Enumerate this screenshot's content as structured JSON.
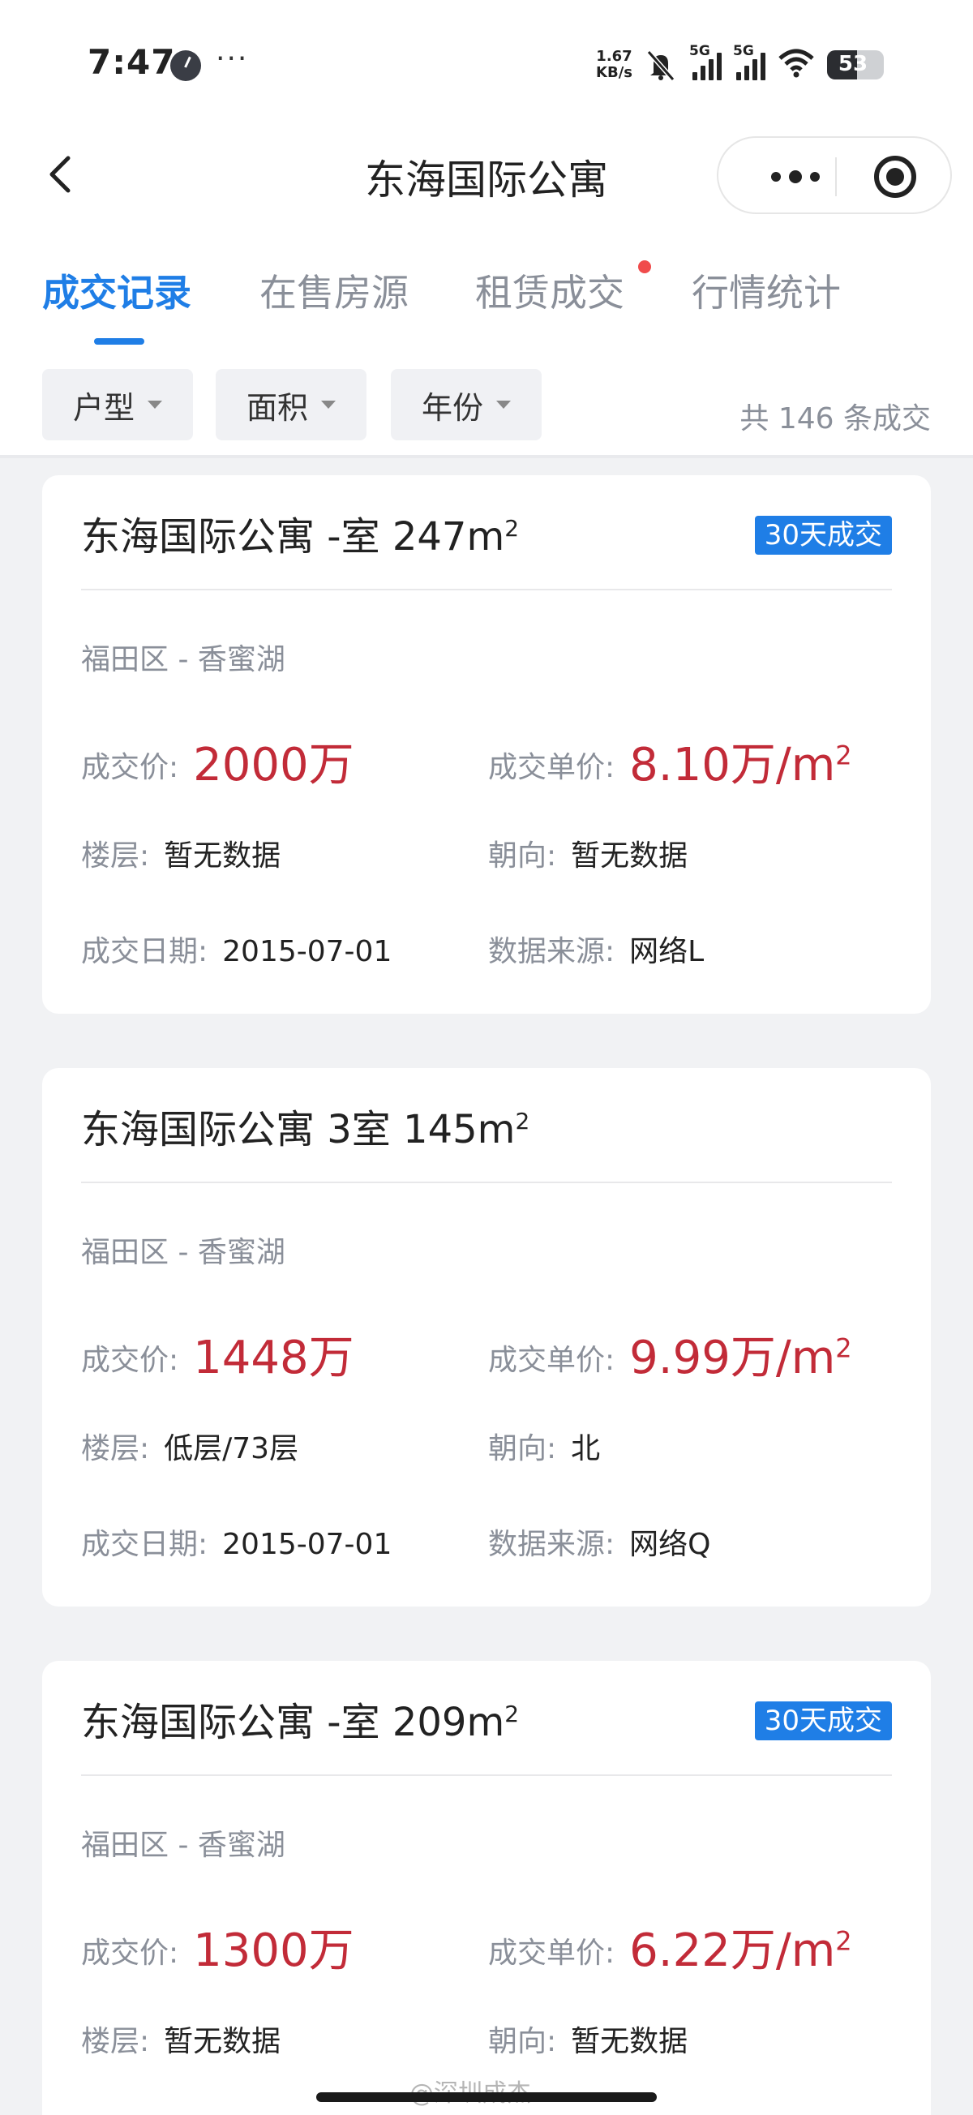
{
  "status_bar": {
    "time": "7:47",
    "dots": "···",
    "speed_value": "1.67",
    "speed_unit": "KB/s",
    "signal1_label": "5G",
    "signal2_label": "5G",
    "battery": "53"
  },
  "nav": {
    "title": "东海国际公寓"
  },
  "tabs": [
    {
      "label": "成交记录",
      "active": true
    },
    {
      "label": "在售房源",
      "active": false
    },
    {
      "label": "租赁成交",
      "active": false,
      "red_dot": true
    },
    {
      "label": "行情统计",
      "active": false
    }
  ],
  "filters": {
    "items": [
      "户型",
      "面积",
      "年份"
    ],
    "total": "共 146 条成交"
  },
  "labels": {
    "price": "成交价:",
    "unit_price": "成交单价:",
    "floor": "楼层:",
    "orientation": "朝向:",
    "date": "成交日期:",
    "source": "数据来源:"
  },
  "cards": [
    {
      "title": "东海国际公寓 -室 247m",
      "badge": "30天成交",
      "district": "福田区 - 香蜜湖",
      "price": "2000万",
      "unit_price": "8.10万/m",
      "floor": "暂无数据",
      "orientation": "暂无数据",
      "date": "2015-07-01",
      "source": "网络L"
    },
    {
      "title": "东海国际公寓 3室 145m",
      "badge": "",
      "district": "福田区 - 香蜜湖",
      "price": "1448万",
      "unit_price": "9.99万/m",
      "floor": "低层/73层",
      "orientation": "北",
      "date": "2015-07-01",
      "source": "网络Q"
    },
    {
      "title": "东海国际公寓 -室 209m",
      "badge": "30天成交",
      "district": "福田区 - 香蜜湖",
      "price": "1300万",
      "unit_price": "6.22万/m",
      "floor": "暂无数据",
      "orientation": "暂无数据"
    }
  ],
  "superscript": "2",
  "watermark": "@深圳成杰"
}
